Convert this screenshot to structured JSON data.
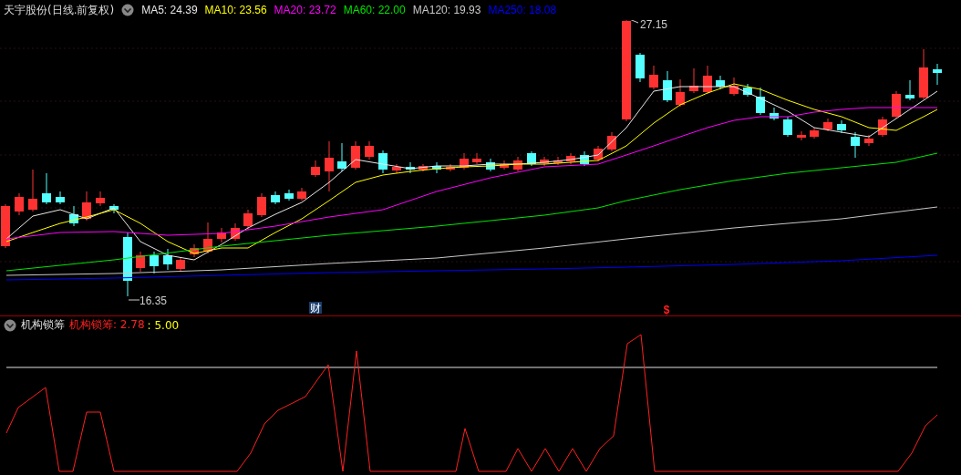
{
  "header": {
    "title": "天宇股份(日线.前复权)",
    "indicators": [
      {
        "label": "MA5: 24.39",
        "color": "#e8e8e8"
      },
      {
        "label": "MA10: 23.56",
        "color": "#ffff00"
      },
      {
        "label": "MA20: 23.72",
        "color": "#ff00ff"
      },
      {
        "label": "MA60: 22.00",
        "color": "#00e600"
      },
      {
        "label": "MA120: 19.93",
        "color": "#c8c8c8"
      },
      {
        "label": "MA250: 18.08",
        "color": "#0000ff"
      }
    ]
  },
  "price_chart": {
    "high_label": "27.15",
    "low_label": "16.35",
    "markers": [
      {
        "kind": "finance",
        "text": "财"
      },
      {
        "kind": "dollar",
        "text": "$"
      }
    ]
  },
  "sub_panel": {
    "title": "机构锁筹",
    "indicators": [
      {
        "label": "机构锁筹: 2.78",
        "color": "#ff2020"
      },
      {
        "label": ": 5.00",
        "color": "#ffff00"
      }
    ]
  }
}
